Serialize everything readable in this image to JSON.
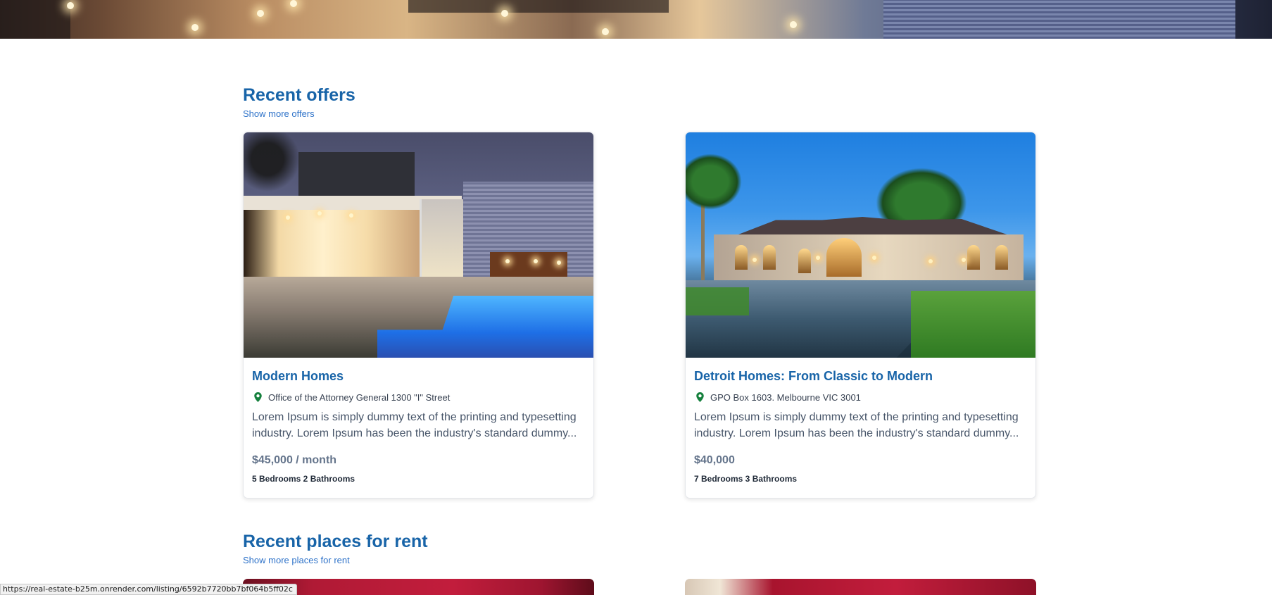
{
  "recent_offers": {
    "title": "Recent offers",
    "link": "Show more offers",
    "cards": [
      {
        "title": "Modern Homes",
        "address": "Office of the Attorney General 1300 \"I\" Street",
        "description": "Lorem Ipsum is simply dummy text of the printing and typesetting industry. Lorem Ipsum has been the industry's standard dummy...",
        "price": "$45,000 / month",
        "specs": "5 Bedrooms 2 Bathrooms"
      },
      {
        "title": "Detroit Homes: From Classic to Modern",
        "address": "GPO Box 1603. Melbourne VIC 3001",
        "description": "Lorem Ipsum is simply dummy text of the printing and typesetting industry. Lorem Ipsum has been the industry's standard dummy...",
        "price": "$40,000",
        "specs": "7 Bedrooms 3 Bathrooms"
      }
    ]
  },
  "recent_rent": {
    "title": "Recent places for rent",
    "link": "Show more places for rent"
  },
  "status_bar": {
    "url": "https://real-estate-b25m.onrender.com/listing/6592b7720bb7bf064b5ff02c"
  },
  "colors": {
    "heading": "#1864a8",
    "link": "#2f73c9",
    "pin": "#15803d"
  },
  "icons": {
    "address": "map-pin-icon"
  }
}
